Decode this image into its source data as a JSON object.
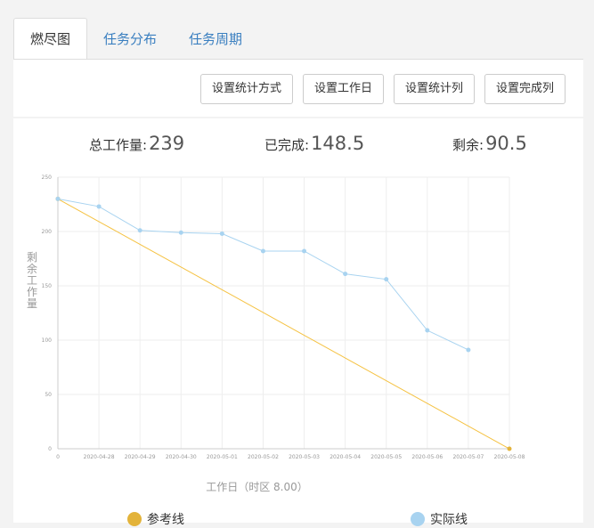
{
  "tabs": [
    {
      "label": "燃尽图",
      "active": true
    },
    {
      "label": "任务分布",
      "active": false
    },
    {
      "label": "任务周期",
      "active": false
    }
  ],
  "toolbar": {
    "stat_method": "设置统计方式",
    "workday": "设置工作日",
    "stat_column": "设置统计列",
    "done_column": "设置完成列"
  },
  "summary": {
    "total_label": "总工作量:",
    "total_value": "239",
    "done_label": "已完成:",
    "done_value": "148.5",
    "remain_label": "剩余:",
    "remain_value": "90.5"
  },
  "chart_data": {
    "type": "line",
    "categories": [
      "0",
      "2020-04-28",
      "2020-04-29",
      "2020-04-30",
      "2020-05-01",
      "2020-05-02",
      "2020-05-03",
      "2020-05-04",
      "2020-05-05",
      "2020-05-06",
      "2020-05-07",
      "2020-05-08"
    ],
    "xlabel": "工作日（时区 8.00）",
    "ylabel": "剩余工作量",
    "ylim": [
      0,
      250
    ],
    "yticks": [
      0,
      50,
      100,
      150,
      200,
      250
    ],
    "grid": true,
    "legend_position": "bottom",
    "series": [
      {
        "name": "参考线",
        "color": "#f5c242",
        "marker_color": "#e3b33a",
        "values": [
          230,
          209.1,
          188.2,
          167.3,
          146.4,
          125.5,
          104.5,
          83.6,
          62.7,
          41.8,
          20.9,
          0
        ]
      },
      {
        "name": "实际线",
        "color": "#a8d3f0",
        "marker_color": "#a8d3f0",
        "values": [
          230,
          223,
          201,
          199,
          198,
          182,
          182,
          161,
          156,
          109,
          91,
          null
        ]
      }
    ]
  }
}
